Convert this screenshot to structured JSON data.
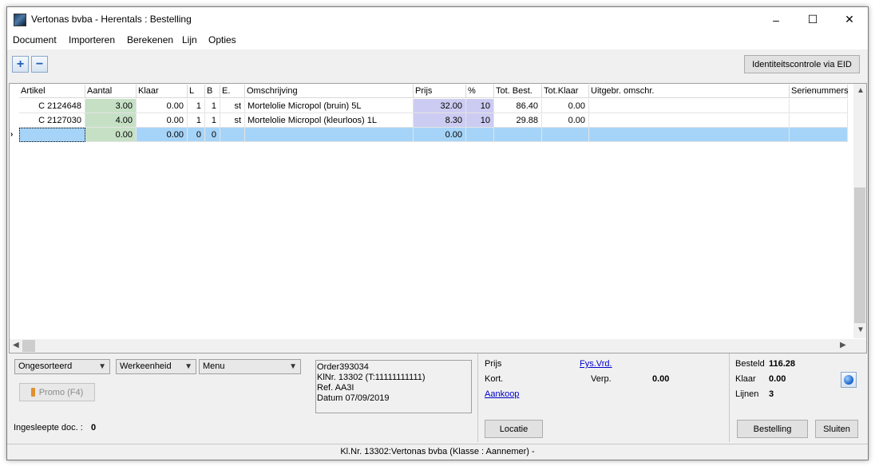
{
  "window": {
    "title": "Vertonas bvba - Herentals : Bestelling",
    "minimize": "–",
    "maximize": "☐",
    "close": "✕"
  },
  "menu": [
    "Document",
    "Importeren",
    "Berekenen",
    "Lijn",
    "Opties"
  ],
  "toolbar": {
    "add_label": "+",
    "remove_label": "−",
    "eid_button": "Identiteitscontrole via EID"
  },
  "grid": {
    "columns": [
      "Artikel",
      "Aantal",
      "Klaar",
      "L",
      "B",
      "E.",
      "Omschrijving",
      "Prijs",
      "%",
      "Tot. Best.",
      "Tot.Klaar",
      "Uitgebr. omschr.",
      "Serienummers"
    ],
    "rows": [
      {
        "artikel": "C 2124648",
        "aantal": "3.00",
        "klaar": "0.00",
        "l": "1",
        "b": "1",
        "e": "st",
        "omschrijving": "Mortelolie Micropol (bruin) 5L",
        "prijs": "32.00",
        "pct": "10",
        "tot_best": "86.40",
        "tot_klaar": "0.00",
        "uitgebr": "",
        "serie": ""
      },
      {
        "artikel": "C 2127030",
        "aantal": "4.00",
        "klaar": "0.00",
        "l": "1",
        "b": "1",
        "e": "st",
        "omschrijving": "Mortelolie Micropol (kleurloos) 1L",
        "prijs": "8.30",
        "pct": "10",
        "tot_best": "29.88",
        "tot_klaar": "0.00",
        "uitgebr": "",
        "serie": ""
      },
      {
        "artikel": "",
        "aantal": "0.00",
        "klaar": "0.00",
        "l": "0",
        "b": "0",
        "e": "",
        "omschrijving": "",
        "prijs": "0.00",
        "pct": "",
        "tot_best": "",
        "tot_klaar": "",
        "uitgebr": "",
        "serie": ""
      }
    ]
  },
  "bottom_left": {
    "sort_combo": "Ongesorteerd",
    "unit_combo": "Werkeenheid",
    "menu_combo": "Menu",
    "promo_button": "Promo (F4)",
    "dropped_docs_label": "Ingesleepte doc. :",
    "dropped_docs_value": "0"
  },
  "order_info": {
    "line1": "Order393034",
    "line2": "KlNr. 13302 (T:11111111111)",
    "line3": "Ref. AA3I",
    "line4": "Datum 07/09/2019"
  },
  "pricing": {
    "prijs_label": "Prijs",
    "fys_link": "Fys.Vrd.",
    "kort_label": "Kort.",
    "verp_label": "Verp.",
    "verp_value": "0.00",
    "aankoop_link": "Aankoop",
    "locatie_button": "Locatie"
  },
  "totals": {
    "besteld_label": "Besteld",
    "besteld_value": "116.28",
    "klaar_label": "Klaar",
    "klaar_value": "0.00",
    "lijnen_label": "Lijnen",
    "lijnen_value": "3",
    "bestelling_button": "Bestelling",
    "sluiten_button": "Sluiten"
  },
  "status": "Kl.Nr. 13302:Vertonas bvba (Klasse : Aannemer) -"
}
